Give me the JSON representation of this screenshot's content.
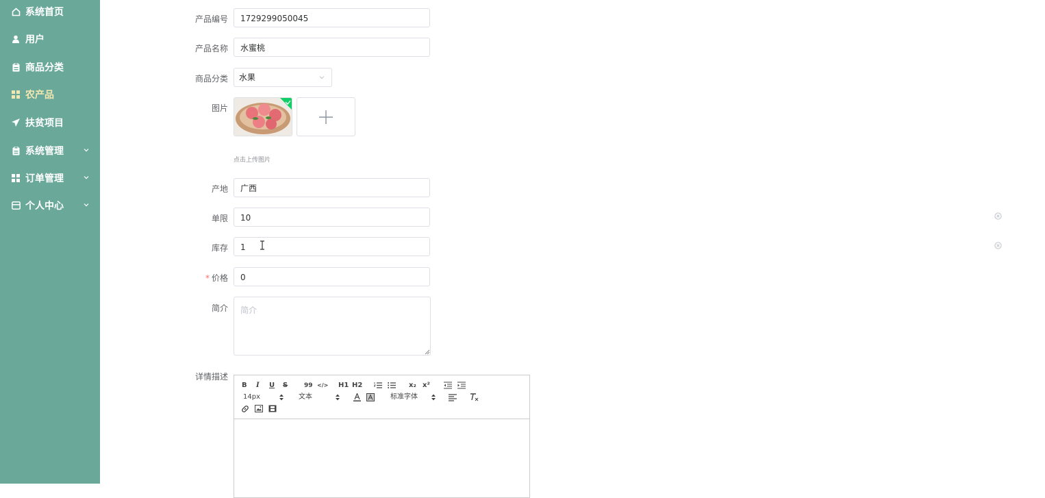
{
  "sidebar": {
    "bg_color": "#6aa99a",
    "active_color": "#f3e7b1",
    "items": [
      {
        "label": "系统首页",
        "icon": "home-icon"
      },
      {
        "label": "用户",
        "icon": "user-icon"
      },
      {
        "label": "商品分类",
        "icon": "clipboard-icon"
      },
      {
        "label": "农产品",
        "icon": "grid-icon",
        "active": true
      },
      {
        "label": "扶贫项目",
        "icon": "send-icon"
      },
      {
        "label": "系统管理",
        "icon": "clipboard-icon",
        "expandable": true
      },
      {
        "label": "订单管理",
        "icon": "grid-icon",
        "expandable": true
      },
      {
        "label": "个人中心",
        "icon": "card-icon",
        "expandable": true
      }
    ]
  },
  "form": {
    "product_no": {
      "label": "产品编号",
      "value": "1729299050045"
    },
    "product_name": {
      "label": "产品名称",
      "value": "水蜜桃"
    },
    "category": {
      "label": "商品分类",
      "value": "水果"
    },
    "image": {
      "label": "图片",
      "hint": "点击上传图片"
    },
    "origin": {
      "label": "产地",
      "value": "广西"
    },
    "limit": {
      "label": "单限",
      "value": "10"
    },
    "stock": {
      "label": "库存",
      "value": "1"
    },
    "price": {
      "label": "价格",
      "value": "0",
      "required_mark": "*"
    },
    "intro": {
      "label": "简介",
      "placeholder": "简介"
    },
    "detail": {
      "label": "详情描述"
    }
  },
  "editor": {
    "font_size": "14px",
    "header_select": "文本",
    "font_family": "标准字体",
    "buttons": {
      "bold": "B",
      "italic": "I",
      "underline": "U",
      "strike": "S",
      "quote": "99",
      "code": "</>",
      "h1": "H1",
      "h2": "H2",
      "sub": "x₂",
      "sup": "x²"
    }
  }
}
